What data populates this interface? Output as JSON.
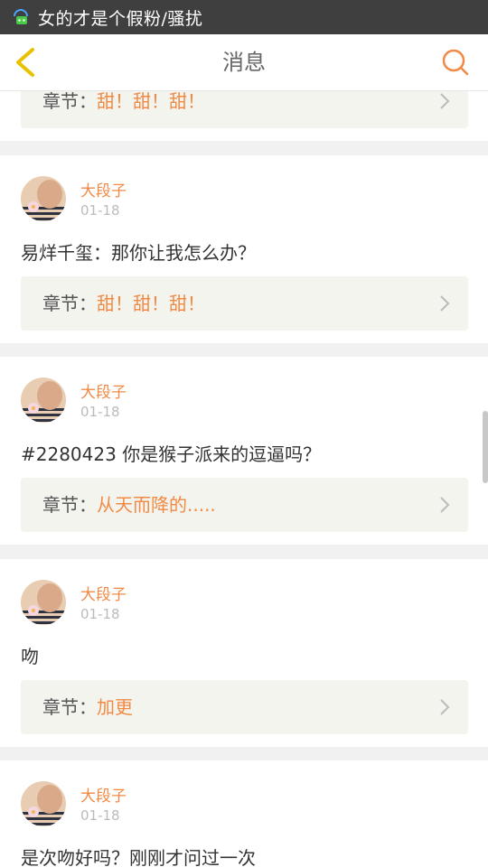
{
  "status_bar": {
    "title": "女的才是个假粉/骚扰"
  },
  "nav": {
    "title": "消息"
  },
  "chapter_label": "章节：",
  "partial_card": {
    "chapter": "甜！甜！甜！"
  },
  "messages": [
    {
      "user": "大段子",
      "date": "01-18",
      "text": "易烊千玺：那你让我怎么办？",
      "chapter": "甜！甜！甜！"
    },
    {
      "user": "大段子",
      "date": "01-18",
      "text": "#2280423 你是猴子派来的逗逼吗？",
      "chapter": "从天而降的....."
    },
    {
      "user": "大段子",
      "date": "01-18",
      "text": "吻",
      "chapter": "加更"
    },
    {
      "user": "大段子",
      "date": "01-18",
      "text": "是次吻好吗？刚刚才问过一次"
    }
  ],
  "colors": {
    "accent": "#f08a45",
    "back_icon": "#e8c200",
    "status_bg": "#3f3f3f"
  },
  "icons": {
    "back": "chevron-left-icon",
    "search": "search-icon",
    "chevron": "chevron-right-icon"
  }
}
